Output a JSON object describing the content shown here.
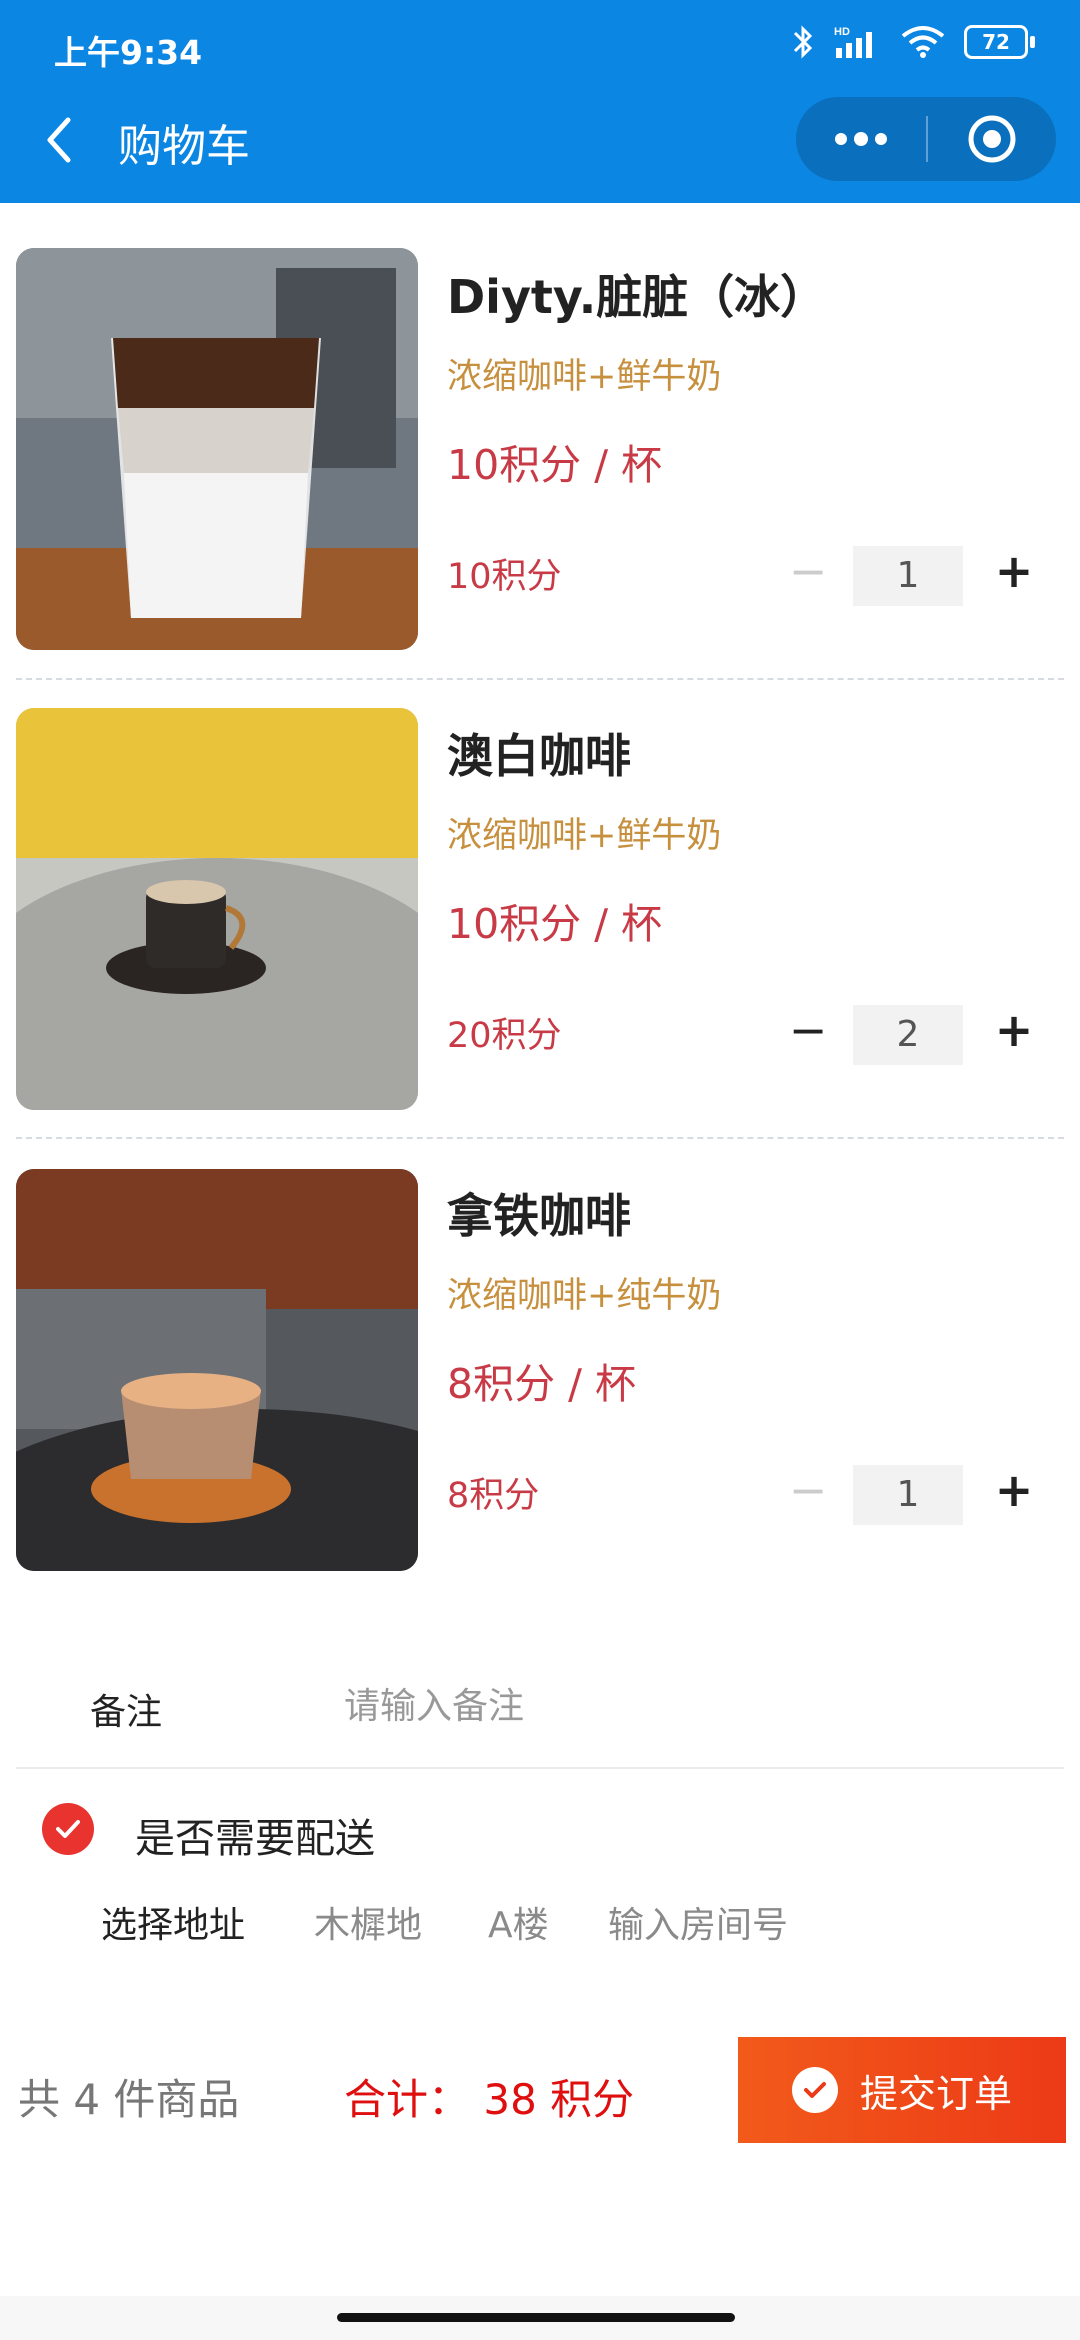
{
  "status_bar": {
    "time": "上午9:34",
    "battery": "72",
    "network": "HD"
  },
  "nav": {
    "title": "购物车"
  },
  "items": [
    {
      "name": "Diyty.脏脏（冰）",
      "desc": "浓缩咖啡+鲜牛奶",
      "price": "10积分 / 杯",
      "subtotal": "10积分",
      "qty": "1",
      "minus_enabled": false
    },
    {
      "name": "澳白咖啡",
      "desc": "浓缩咖啡+鲜牛奶",
      "price": "10积分 / 杯",
      "subtotal": "20积分",
      "qty": "2",
      "minus_enabled": true
    },
    {
      "name": "拿铁咖啡",
      "desc": "浓缩咖啡+纯牛奶",
      "price": "8积分 / 杯",
      "subtotal": "8积分",
      "qty": "1",
      "minus_enabled": false
    }
  ],
  "stepper": {
    "minus": "−",
    "plus": "+"
  },
  "remark": {
    "label": "备注",
    "placeholder": "请输入备注",
    "value": ""
  },
  "delivery": {
    "label": "是否需要配送",
    "checked": true
  },
  "address": {
    "label": "选择地址",
    "option1": "木樨地",
    "option2": "A楼",
    "room_placeholder": "输入房间号"
  },
  "footer": {
    "count_text": "共 4 件商品",
    "total_text": "合计：  38 积分",
    "submit_label": "提交订单"
  },
  "colors": {
    "header": "#0b86e3",
    "accent_red": "#e00f0f",
    "price": "#c83b46",
    "desc": "#c7903e",
    "submit": "#ec3a17"
  }
}
